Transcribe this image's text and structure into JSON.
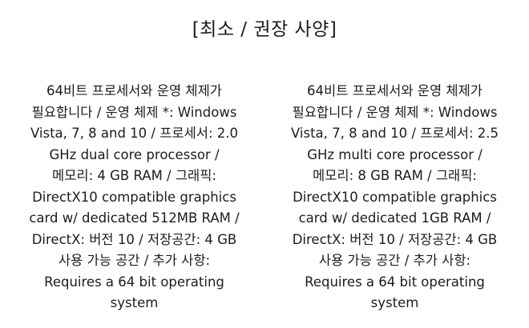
{
  "title": "[최소 / 권장 사양]",
  "minimum": {
    "lines": [
      "64비트 프로세서와 운영 체제가",
      "필요합니다 / 운영 체제 *: Windows",
      "Vista, 7, 8 and 10 / 프로세서: 2.0",
      "GHz dual core processor /",
      "메모리: 4 GB RAM / 그래픽:",
      "DirectX10 compatible graphics",
      "card w/ dedicated 512MB RAM /",
      "DirectX: 버전 10 / 저장공간: 4 GB",
      "사용 가능 공간 / 추가 사항:",
      "Requires a 64 bit operating",
      "system"
    ]
  },
  "recommended": {
    "lines": [
      "64비트 프로세서와 운영 체제가",
      "필요합니다 / 운영 체제 *: Windows",
      "Vista, 7, 8 and 10 / 프로세서: 2.5",
      "GHz multi core processor /",
      "메모리: 8 GB RAM / 그래픽:",
      "DirectX10 compatible graphics",
      "card w/ dedicated 1GB RAM /",
      "DirectX: 버전 10 / 저장공간: 4 GB",
      "사용 가능 공간 / 추가 사항:",
      "Requires a 64 bit operating",
      "system"
    ]
  }
}
